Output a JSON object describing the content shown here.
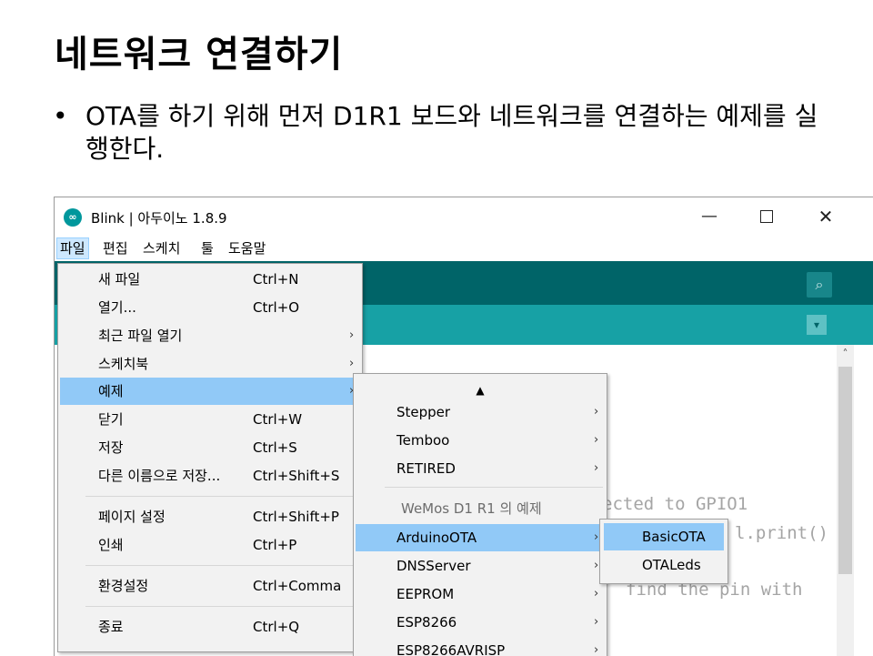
{
  "slide": {
    "title": "네트워크 연결하기",
    "bullet": "•",
    "text": "OTA를 하기 위해 먼저 D1R1 보드와 네트워크를 연결하는 예제를 실행한다."
  },
  "window": {
    "logo": "∞",
    "title": "Blink | 아두이노 1.8.9",
    "minimize": "—",
    "close": "✕"
  },
  "menubar": [
    {
      "label": "파일"
    },
    {
      "label": "편집"
    },
    {
      "label": "스케치"
    },
    {
      "label": "툴"
    },
    {
      "label": "도움말"
    }
  ],
  "toolbar": {
    "serial_icon": "⌕",
    "dropdown_icon": "▾"
  },
  "editor": {
    "code": [
      "ected to GPIO1",
      "l.print()",
      "find the pin with"
    ],
    "scroll_up": "˄"
  },
  "file_menu": {
    "items": [
      {
        "label": "새 파일",
        "shortcut": "Ctrl+N",
        "arrow": ""
      },
      {
        "label": "열기...",
        "shortcut": "Ctrl+O",
        "arrow": ""
      },
      {
        "label": "최근 파일 열기",
        "shortcut": "",
        "arrow": "›"
      },
      {
        "label": "스케치북",
        "shortcut": "",
        "arrow": "›"
      },
      {
        "label": "예제",
        "shortcut": "",
        "arrow": "›"
      },
      {
        "label": "닫기",
        "shortcut": "Ctrl+W",
        "arrow": ""
      },
      {
        "label": "저장",
        "shortcut": "Ctrl+S",
        "arrow": ""
      },
      {
        "label": "다른 이름으로 저장...",
        "shortcut": "Ctrl+Shift+S",
        "arrow": ""
      },
      {
        "label": "페이지 설정",
        "shortcut": "Ctrl+Shift+P",
        "arrow": ""
      },
      {
        "label": "인쇄",
        "shortcut": "Ctrl+P",
        "arrow": ""
      },
      {
        "label": "환경설정",
        "shortcut": "Ctrl+Comma",
        "arrow": ""
      },
      {
        "label": "종료",
        "shortcut": "Ctrl+Q",
        "arrow": ""
      }
    ]
  },
  "examples_menu": {
    "scroll_up_icon": "▲",
    "items": [
      {
        "label": "Stepper",
        "arrow": "›"
      },
      {
        "label": "Temboo",
        "arrow": "›"
      },
      {
        "label": "RETIRED",
        "arrow": "›"
      }
    ],
    "section_header": "WeMos D1 R1 의 예제",
    "board_items": [
      {
        "label": "ArduinoOTA",
        "arrow": "›"
      },
      {
        "label": "DNSServer",
        "arrow": "›"
      },
      {
        "label": "EEPROM",
        "arrow": "›"
      },
      {
        "label": "ESP8266",
        "arrow": "›"
      },
      {
        "label": "ESP8266AVRISP",
        "arrow": "›"
      }
    ]
  },
  "ota_menu": {
    "items": [
      {
        "label": "BasicOTA"
      },
      {
        "label": "OTALeds"
      }
    ]
  }
}
